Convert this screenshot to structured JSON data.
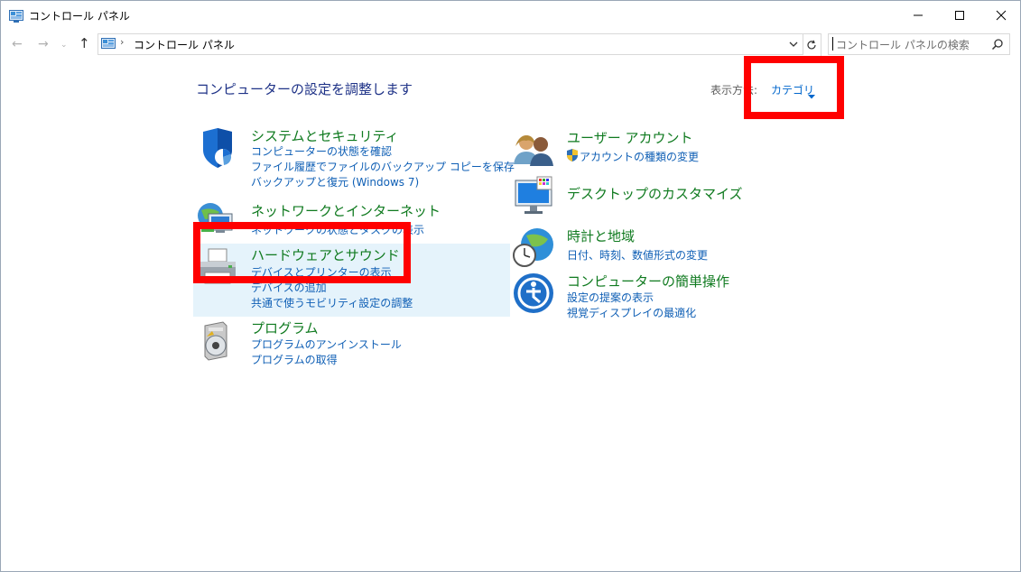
{
  "window": {
    "title": "コントロール パネル",
    "controls": {
      "minimize": "minimize-icon",
      "maximize": "maximize-icon",
      "close": "close-icon"
    }
  },
  "address": {
    "path": "コントロール パネル",
    "search_placeholder": "コントロール パネルの検索"
  },
  "main": {
    "title": "コンピューターの設定を調整します",
    "view_by_label": "表示方法:",
    "view_by_value": "カテゴリ"
  },
  "categories_left": [
    {
      "title": "システムとセキュリティ",
      "icon": "shield-icon",
      "links": [
        "コンピューターの状態を確認",
        "ファイル履歴でファイルのバックアップ コピーを保存",
        "バックアップと復元 (Windows 7)"
      ]
    },
    {
      "title": "ネットワークとインターネット",
      "icon": "network-icon",
      "links": [
        "ネットワークの状態とタスクの表示"
      ]
    },
    {
      "title": "ハードウェアとサウンド",
      "icon": "printer-icon",
      "links": [
        "デバイスとプリンターの表示",
        "デバイスの追加",
        "共通で使うモビリティ設定の調整"
      ]
    },
    {
      "title": "プログラム",
      "icon": "programs-icon",
      "links": [
        "プログラムのアンインストール",
        "プログラムの取得"
      ]
    }
  ],
  "categories_right": [
    {
      "title": "ユーザー アカウント",
      "icon": "users-icon",
      "links": [
        "アカウントの種類の変更"
      ]
    },
    {
      "title": "デスクトップのカスタマイズ",
      "icon": "monitor-icon",
      "links": []
    },
    {
      "title": "時計と地域",
      "icon": "clock-globe-icon",
      "links": [
        "日付、時刻、数値形式の変更"
      ]
    },
    {
      "title": "コンピューターの簡単操作",
      "icon": "ease-of-access-icon",
      "links": [
        "設定の提案の表示",
        "視覚ディスプレイの最適化"
      ]
    }
  ],
  "colors": {
    "heading": "#0f7a1f",
    "link": "#0f5fb5",
    "title": "#1e3287",
    "annotation": "#ff0000",
    "hover": "#e5f3fb"
  }
}
